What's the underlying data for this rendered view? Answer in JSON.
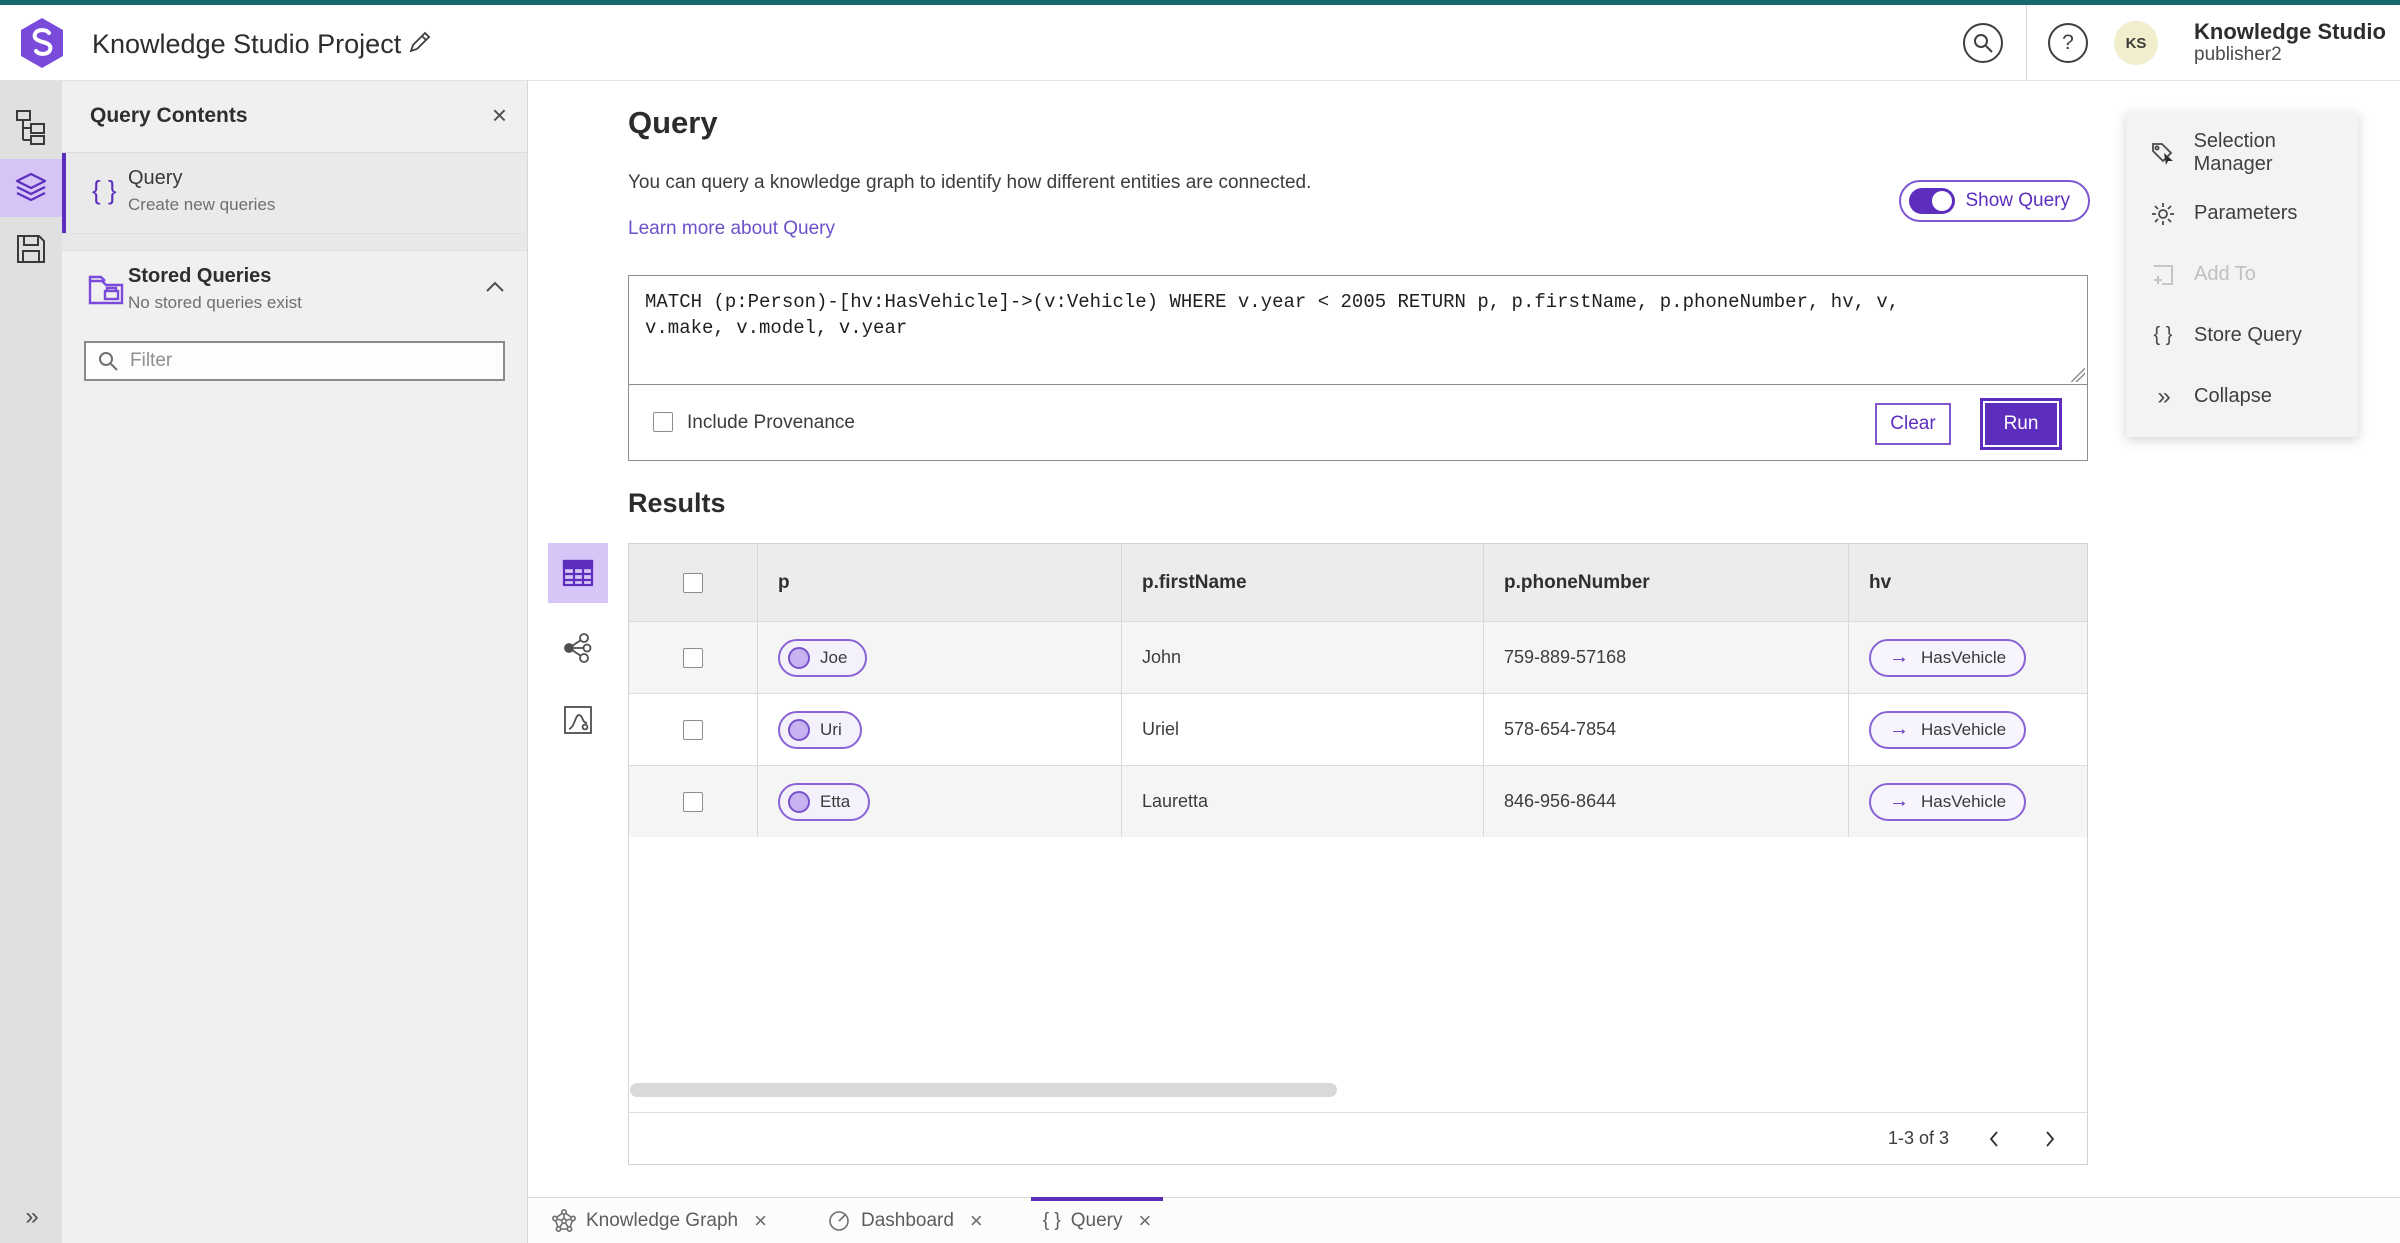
{
  "colors": {
    "accent": "#5d2ebe",
    "accent_light": "#d6c5f6",
    "top_strip_teal": "#15696d",
    "link": "#6d51c9"
  },
  "icons": {
    "braces": "{ }",
    "collapse_chevrons": "»",
    "rail_expand": "»",
    "arrow_right": "→",
    "question_mark": "?",
    "close": "×"
  },
  "header": {
    "title": "Knowledge Studio Project",
    "account_name": "Knowledge Studio",
    "account_user": "publisher2",
    "avatar_initials": "KS"
  },
  "contents_panel": {
    "title": "Query Contents",
    "query_item_title": "Query",
    "query_item_subtitle": "Create new queries",
    "stored_title": "Stored Queries",
    "stored_subtitle": "No stored queries exist",
    "filter_placeholder": "Filter"
  },
  "query_section": {
    "heading": "Query",
    "description": "You can query a knowledge graph to identify how different entities are connected.",
    "learn_more": "Learn more about Query",
    "show_query": "Show Query",
    "query_text": "MATCH (p:Person)-[hv:HasVehicle]->(v:Vehicle) WHERE v.year < 2005 RETURN p, p.firstName, p.phoneNumber, hv, v,\nv.make, v.model, v.year",
    "include_provenance": "Include Provenance",
    "clear": "Clear",
    "run": "Run"
  },
  "results": {
    "heading": "Results",
    "columns": {
      "c0": "p",
      "c1": "p.firstName",
      "c2": "p.phoneNumber",
      "c3": "hv"
    },
    "rows": [
      {
        "p": "Joe",
        "firstName": "John",
        "phone": "759-889-57168",
        "hv": "HasVehicle"
      },
      {
        "p": "Uri",
        "firstName": "Uriel",
        "phone": "578-654-7854",
        "hv": "HasVehicle"
      },
      {
        "p": "Etta",
        "firstName": "Lauretta",
        "phone": "846-956-8644",
        "hv": "HasVehicle"
      }
    ],
    "pagination": "1-3 of 3"
  },
  "actions": {
    "selection_manager": "Selection Manager",
    "parameters": "Parameters",
    "add_to": "Add To",
    "store_query": "Store Query",
    "collapse": "Collapse"
  },
  "tabs": {
    "knowledge_graph": "Knowledge Graph",
    "dashboard": "Dashboard",
    "query": "Query"
  }
}
